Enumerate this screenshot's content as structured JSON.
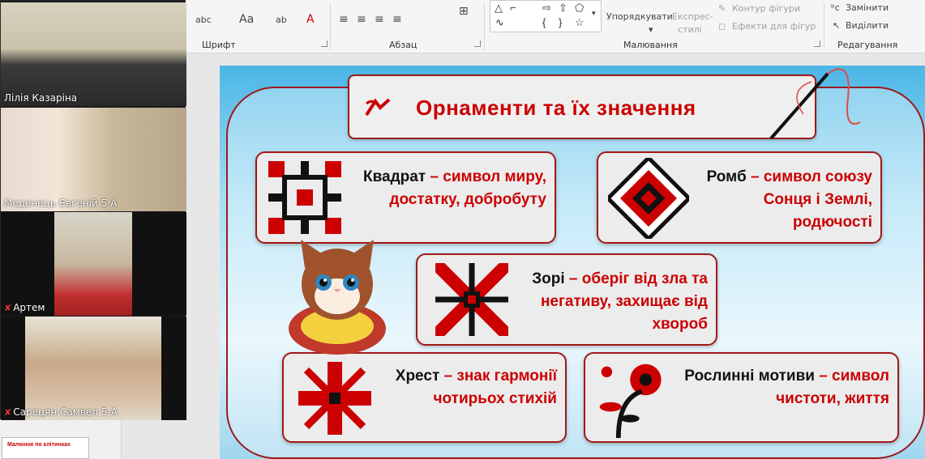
{
  "ribbon": {
    "groups": {
      "font": "Шрифт",
      "paragraph": "Абзац",
      "drawing": "Малювання",
      "editing": "Редагування"
    },
    "font_tools": [
      "abc",
      "Aa",
      "ab"
    ],
    "arrange": "Упорядкувати",
    "quick_styles_line1": "Експрес-",
    "quick_styles_line2": "стилі",
    "shape_outline": "Контур фігури",
    "shape_effects": "Ефекти для фігур",
    "replace": "Замінити",
    "select": "Виділити"
  },
  "participants": [
    {
      "name": "Лілія Казаріна",
      "muted": false,
      "active": true
    },
    {
      "name": "Меденець Євгеній 5 А",
      "muted": false,
      "active": false
    },
    {
      "name": "Артем",
      "muted": true,
      "active": false
    },
    {
      "name": "Сарецян Самвел 5-А",
      "muted": true,
      "active": false
    }
  ],
  "thumbnail": {
    "text": "Малюнок по клітинках"
  },
  "slide": {
    "title": "Орнаменти та їх значення",
    "cards": [
      {
        "head": "Квадрат",
        "text": " – символ миру, достатку, добробуту"
      },
      {
        "head": "Ромб",
        "text": " – символ союзу Сонця і Землі, родючості"
      },
      {
        "head": "Зорі",
        "text": " – оберіг від зла та негативу, захищає від хвороб"
      },
      {
        "head": "Хрест",
        "text": " – знак гармонії чотирьох стихій"
      },
      {
        "head": "Рослинні мотиви",
        "text": " – символ чистоти, життя"
      }
    ]
  },
  "colors": {
    "accent_red": "#c00000",
    "frame_red": "#9b1b1b",
    "active_tile": "#c9e04a"
  }
}
